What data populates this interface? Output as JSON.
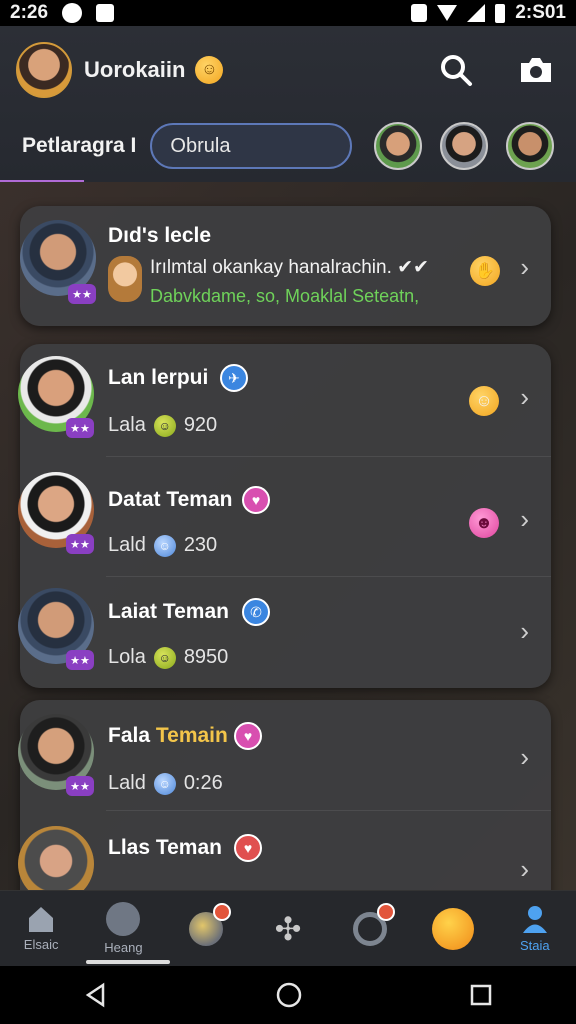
{
  "status_bar": {
    "left_time": "2:26",
    "right_time": "2:S01"
  },
  "header": {
    "title": "Uorokaiin",
    "title_emoji": "☺",
    "filter_label": "Petlaragra I",
    "search_value": "Obrula"
  },
  "chats": [
    {
      "name": "Dıd's lecle",
      "message": "Irılmtal okankay hanalrachin. ✔✔",
      "status_text": "Dabvkdame, so, Moaklal Seteatn,",
      "accent_color": "#6fd25a"
    },
    {
      "name": "Lan lerpui",
      "sub_label": "Lala",
      "sub_value": "920",
      "verify": "✈",
      "right_emoji": "☺"
    },
    {
      "name": "Datat Teman",
      "sub_label": "Lald",
      "sub_value": "230",
      "verify": "♥",
      "right_emoji": "☻"
    },
    {
      "name": "Laiat Teman",
      "sub_label": "Lola",
      "sub_value": "8950",
      "verify": "✆"
    },
    {
      "name_prefix": "Fala",
      "name_highlight": "Temain",
      "sub_label": "Lald",
      "sub_value": "0:26",
      "verify": "♥"
    },
    {
      "name": "Llas Teman",
      "verify": "♥"
    }
  ],
  "bottom_nav": {
    "items": [
      {
        "label": "Elsaic",
        "icon": "home-icon"
      },
      {
        "label": "Heang",
        "icon": "people-icon"
      },
      {
        "label": "",
        "icon": "coin-icon"
      },
      {
        "label": "",
        "icon": "tools-icon"
      },
      {
        "label": "",
        "icon": "ring-icon"
      },
      {
        "label": "",
        "icon": "angry-emoji-icon"
      },
      {
        "label": "Staia",
        "icon": "profile-icon"
      }
    ],
    "active_color": "#4ea2f0"
  },
  "colors": {
    "accent_purple": "#8a3fc2",
    "search_border": "#5d78b8",
    "gold_name": "#f3c54a"
  }
}
